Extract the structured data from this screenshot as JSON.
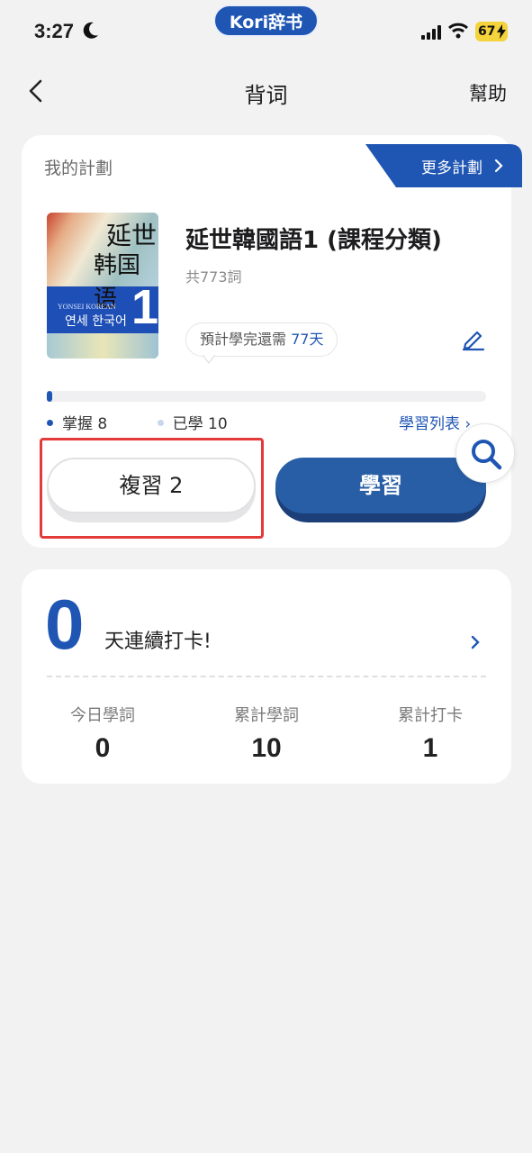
{
  "status_bar": {
    "time": "3:27",
    "app_badge": "Kori辞书",
    "battery": "67"
  },
  "nav": {
    "title": "背词",
    "help": "幫助"
  },
  "plan": {
    "header": "我的計劃",
    "more_plans": "更多計劃",
    "book_title": "延世韓國語1 (課程分類)",
    "word_count": "共773詞",
    "eta_prefix": "預計學完還需",
    "eta_days": "77天",
    "progress_fraction": 0.012,
    "mastered_label": "掌握 8",
    "learned_label": "已學 10",
    "study_list": "學習列表 ›",
    "review_button": "複習 2",
    "learn_button": "學習",
    "cover": {
      "title_line1": "延世",
      "title_line2": "韩国语",
      "volume": "1",
      "english": "YONSEI KOREAN",
      "korean": "연세 한국어"
    }
  },
  "stats": {
    "streak_value": "0",
    "streak_label": "天連續打卡!",
    "items": [
      {
        "label": "今日學詞",
        "value": "0"
      },
      {
        "label": "累計學詞",
        "value": "10"
      },
      {
        "label": "累計打卡",
        "value": "1"
      }
    ]
  },
  "colors": {
    "accent": "#1f56b3",
    "learn_button": "#275ea6",
    "highlight": "#e33a3a",
    "battery": "#f4d33b"
  },
  "icons": [
    "moon-icon",
    "signal-icon",
    "wifi-icon",
    "back-icon",
    "chevron-right-icon",
    "edit-icon",
    "search-icon"
  ]
}
